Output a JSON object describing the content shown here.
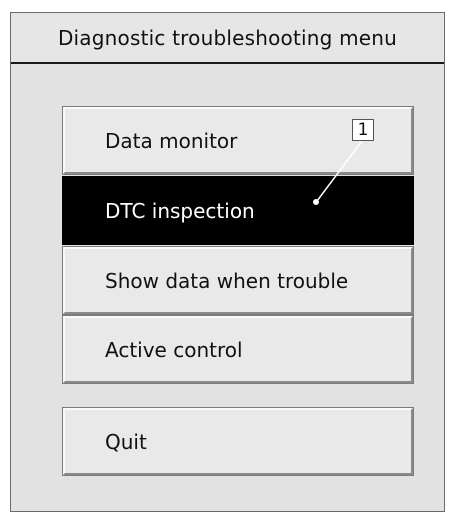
{
  "window": {
    "title": "Diagnostic troubleshooting menu"
  },
  "menu": {
    "items": [
      {
        "label": "Data monitor",
        "selected": false
      },
      {
        "label": "DTC inspection",
        "selected": true
      },
      {
        "label": "Show data when trouble",
        "selected": false
      },
      {
        "label": "Active control",
        "selected": false
      }
    ],
    "quit_label": "Quit"
  },
  "callout": {
    "number": "1"
  }
}
